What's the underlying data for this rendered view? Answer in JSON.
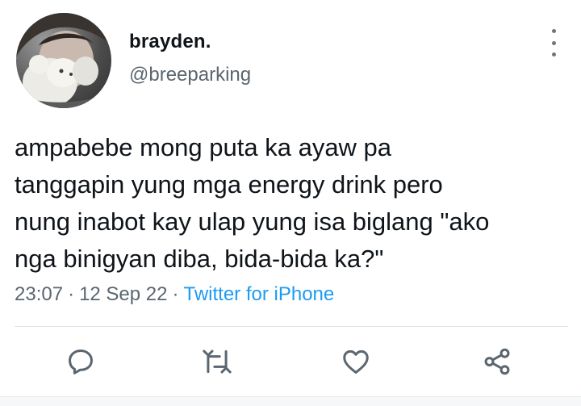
{
  "tweet": {
    "display_name": "brayden.",
    "handle": "@breeparking",
    "text": "ampabebe mong puta ka ayaw pa\ntanggapin yung mga energy drink pero\nnung inabot kay ulap yung isa biglang \"ako\nnga binigyan diba, bida-bida ka?\"",
    "time": "23:07",
    "date": "12 Sep 22",
    "source": "Twitter for iPhone",
    "separator": "·"
  },
  "icons": {
    "avatar": "profile-photo-person-with-white-teddy-bear",
    "more": "more-vertical-icon",
    "reply": "reply-icon",
    "retweet": "retweet-icon",
    "like": "heart-icon",
    "share": "share-icon"
  },
  "colors": {
    "text": "#0f1419",
    "secondary": "#5b6670",
    "link": "#1d9bf0",
    "icon": "#5b6670",
    "divider": "#e1e6ea"
  }
}
